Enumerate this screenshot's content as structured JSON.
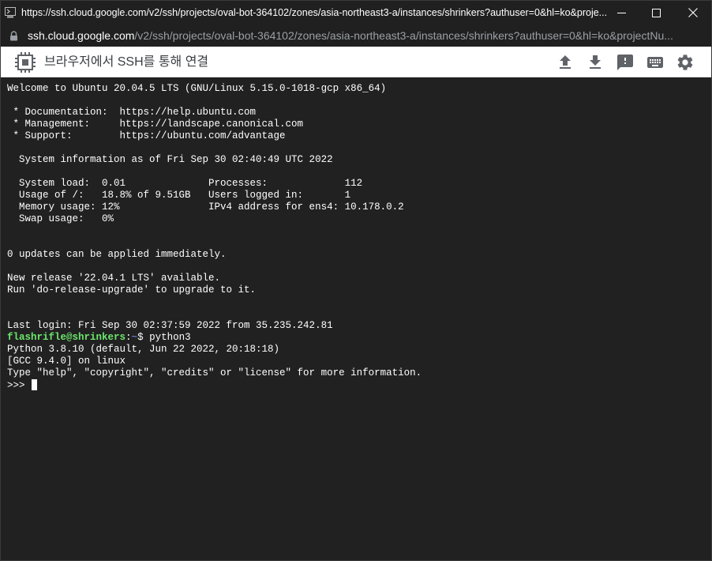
{
  "window": {
    "title": "https://ssh.cloud.google.com/v2/ssh/projects/oval-bot-364102/zones/asia-northeast3-a/instances/shrinkers?authuser=0&hl=ko&proje..."
  },
  "address_bar": {
    "host": "ssh.cloud.google.com",
    "path": "/v2/ssh/projects/oval-bot-364102/zones/asia-northeast3-a/instances/shrinkers?authuser=0&hl=ko&projectNu..."
  },
  "toolbar": {
    "title": "브라우저에서 SSH를 통해 연결",
    "icons": [
      "upload-icon",
      "download-icon",
      "feedback-icon",
      "keyboard-icon",
      "gear-icon"
    ]
  },
  "terminal": {
    "lines_before": [
      "Welcome to Ubuntu 20.04.5 LTS (GNU/Linux 5.15.0-1018-gcp x86_64)",
      "",
      " * Documentation:  https://help.ubuntu.com",
      " * Management:     https://landscape.canonical.com",
      " * Support:        https://ubuntu.com/advantage",
      "",
      "  System information as of Fri Sep 30 02:40:49 UTC 2022",
      "",
      "  System load:  0.01              Processes:             112",
      "  Usage of /:   18.8% of 9.51GB   Users logged in:       1",
      "  Memory usage: 12%               IPv4 address for ens4: 10.178.0.2",
      "  Swap usage:   0%",
      "",
      "",
      "0 updates can be applied immediately.",
      "",
      "New release '22.04.1 LTS' available.",
      "Run 'do-release-upgrade' to upgrade to it.",
      "",
      "",
      "Last login: Fri Sep 30 02:37:59 2022 from 35.235.242.81"
    ],
    "prompt": {
      "user_host": "flashrifle@shrinkers",
      "sep": ":",
      "path": "~",
      "symbol": "$ ",
      "command": "python3"
    },
    "lines_after": [
      "Python 3.8.10 (default, Jun 22 2022, 20:18:18)",
      "[GCC 9.4.0] on linux",
      "Type \"help\", \"copyright\", \"credits\" or \"license\" for more information."
    ],
    "repl_prompt": ">>> "
  }
}
